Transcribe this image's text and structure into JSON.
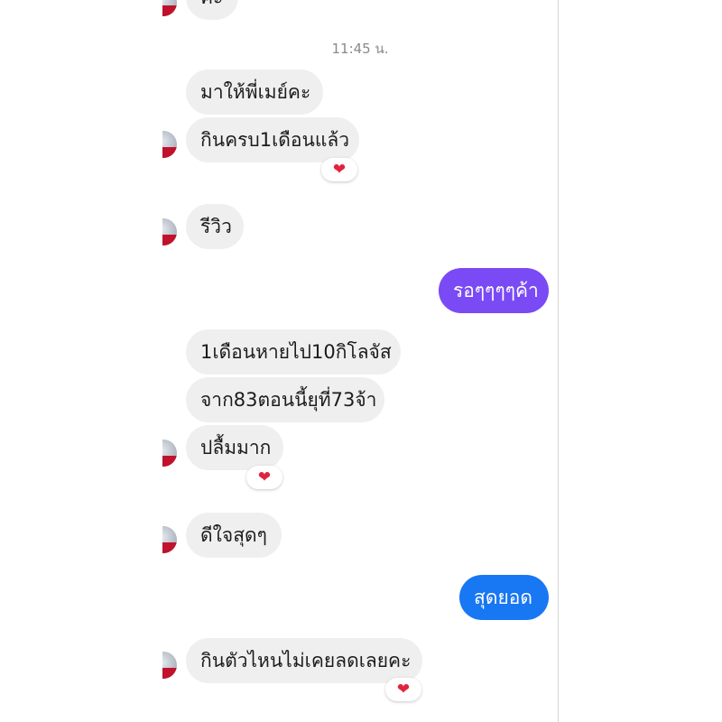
{
  "thread": {
    "top_partial": "คะ",
    "timestamp": "11:45 น.",
    "messages": [
      {
        "text": "มาให้พี่เมย์คะ"
      },
      {
        "text": "กินครบ1เดือนแล้ว"
      },
      {
        "text": "รีวิว"
      },
      {
        "text": "รอๆๆๆๆค้า"
      },
      {
        "text": "1เดือนหายไป10กิโลจัส"
      },
      {
        "text": "จาก83ตอนนี้ยุที่73จ้า"
      },
      {
        "text": "ปลื้มมาก"
      },
      {
        "text": "ดีใจสุดๆ"
      },
      {
        "text": "สุดยอด"
      },
      {
        "text": "กินตัวไหนไม่เคยลดเลยคะ"
      }
    ],
    "reaction_glyph": "❤",
    "colors": {
      "incoming": "#efefef",
      "outgoing_1": "#7a4af4",
      "outgoing_2": "#1877f2",
      "heart": "#e0243d"
    }
  }
}
